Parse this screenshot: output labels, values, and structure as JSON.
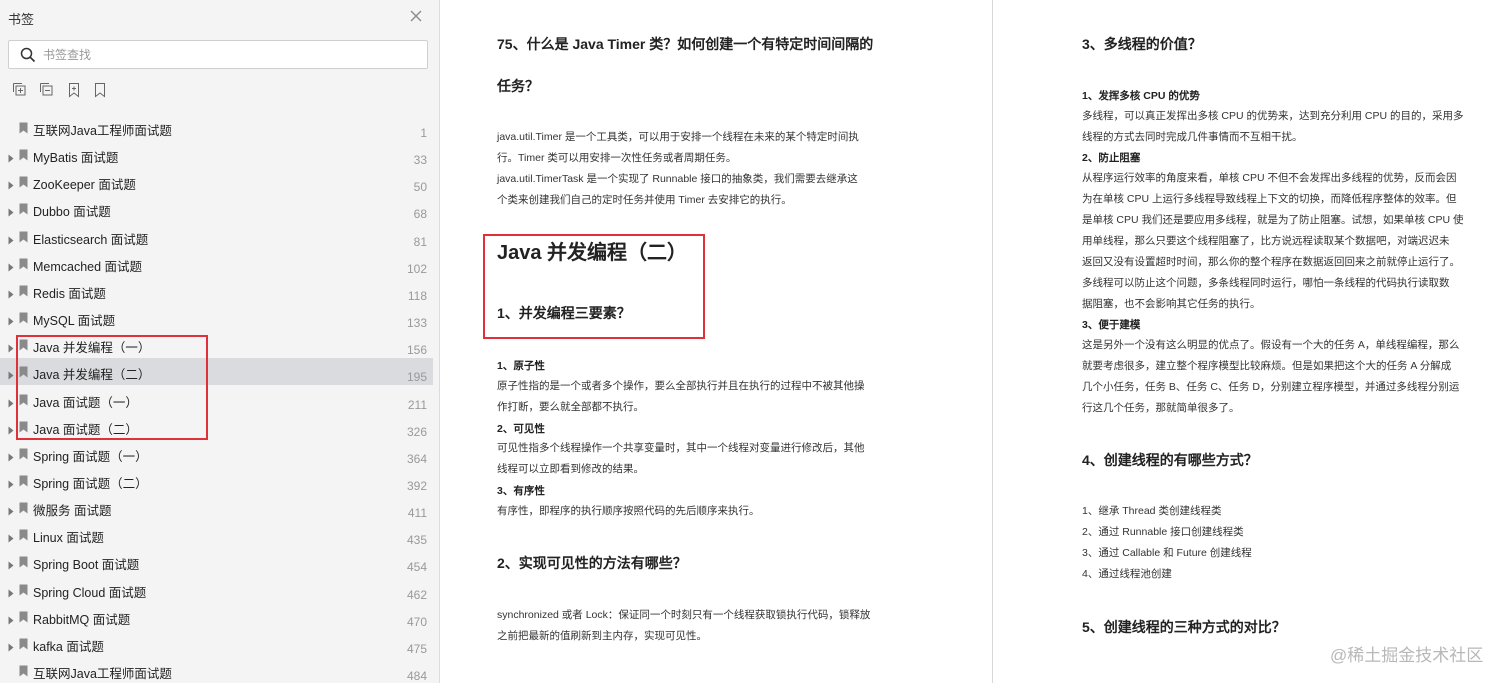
{
  "sidebar": {
    "title": "书签",
    "search_placeholder": "书签查找",
    "items": [
      {
        "label": "互联网Java工程师面试题",
        "page": "1",
        "expandable": false
      },
      {
        "label": "MyBatis 面试题",
        "page": "33",
        "expandable": true
      },
      {
        "label": "ZooKeeper 面试题",
        "page": "50",
        "expandable": true
      },
      {
        "label": "Dubbo 面试题",
        "page": "68",
        "expandable": true
      },
      {
        "label": "Elasticsearch 面试题",
        "page": "81",
        "expandable": true
      },
      {
        "label": "Memcached 面试题",
        "page": "102",
        "expandable": true
      },
      {
        "label": "Redis 面试题",
        "page": "118",
        "expandable": true
      },
      {
        "label": "MySQL 面试题",
        "page": "133",
        "expandable": true
      },
      {
        "label": "Java 并发编程（一）",
        "page": "156",
        "expandable": true
      },
      {
        "label": "Java 并发编程（二）",
        "page": "195",
        "expandable": true,
        "selected": true
      },
      {
        "label": "Java 面试题（一）",
        "page": "211",
        "expandable": true
      },
      {
        "label": "Java 面试题（二）",
        "page": "326",
        "expandable": true
      },
      {
        "label": "Spring 面试题（一）",
        "page": "364",
        "expandable": true
      },
      {
        "label": "Spring 面试题（二）",
        "page": "392",
        "expandable": true
      },
      {
        "label": "微服务 面试题",
        "page": "411",
        "expandable": true
      },
      {
        "label": "Linux 面试题",
        "page": "435",
        "expandable": true
      },
      {
        "label": "Spring Boot 面试题",
        "page": "454",
        "expandable": true
      },
      {
        "label": "Spring Cloud 面试题",
        "page": "462",
        "expandable": true
      },
      {
        "label": "RabbitMQ 面试题",
        "page": "470",
        "expandable": true
      },
      {
        "label": "kafka 面试题",
        "page": "475",
        "expandable": true
      },
      {
        "label": "互联网Java工程师面试题",
        "page": "484",
        "expandable": false
      }
    ]
  },
  "left_page": {
    "q75_title_line1": "75、什么是 Java Timer 类？如何创建一个有特定时间间隔的",
    "q75_title_line2": "任务？",
    "q75_p1": "java.util.Timer 是一个工具类，可以用于安排一个线程在未来的某个特定时间执",
    "q75_p2": "行。Timer 类可以用安排一次性任务或者周期任务。",
    "q75_p3": "java.util.TimerTask 是一个实现了 Runnable 接口的抽象类，我们需要去继承这",
    "q75_p4": "个类来创建我们自己的定时任务并使用 Timer 去安排它的执行。",
    "chapter_title": "Java  并发编程（二）",
    "q1_title": "1、并发编程三要素？",
    "s1_head": "1、原子性",
    "s1_p1": "原子性指的是一个或者多个操作，要么全部执行并且在执行的过程中不被其他操",
    "s1_p2": "作打断，要么就全部都不执行。",
    "s2_head": "2、可见性",
    "s2_p1": "可见性指多个线程操作一个共享变量时，其中一个线程对变量进行修改后，其他",
    "s2_p2": "线程可以立即看到修改的结果。",
    "s3_head": "3、有序性",
    "s3_p1": "有序性，即程序的执行顺序按照代码的先后顺序来执行。",
    "q2_title": "2、实现可见性的方法有哪些？",
    "q2_p1": "synchronized 或者 Lock：保证同一个时刻只有一个线程获取锁执行代码，锁释放",
    "q2_p2": "之前把最新的值刷新到主内存，实现可见性。"
  },
  "right_page": {
    "q3_title": "3、多线程的价值？",
    "a1_head": "1、发挥多核 CPU 的优势",
    "a1_p1": "多线程，可以真正发挥出多核 CPU 的优势来，达到充分利用 CPU 的目的，采用多",
    "a1_p2": "线程的方式去同时完成几件事情而不互相干扰。",
    "a2_head": "2、防止阻塞",
    "a2_p1": "从程序运行效率的角度来看，单核 CPU 不但不会发挥出多线程的优势，反而会因",
    "a2_p2": "为在单核 CPU 上运行多线程导致线程上下文的切换，而降低程序整体的效率。但",
    "a2_p3": "是单核 CPU 我们还是要应用多线程，就是为了防止阻塞。试想，如果单核 CPU 使",
    "a2_p4": "用单线程，那么只要这个线程阻塞了，比方说远程读取某个数据吧，对端迟迟未",
    "a2_p5": "返回又没有设置超时时间，那么你的整个程序在数据返回回来之前就停止运行了。",
    "a2_p6": "多线程可以防止这个问题，多条线程同时运行，哪怕一条线程的代码执行读取数",
    "a2_p7": "据阻塞，也不会影响其它任务的执行。",
    "a3_head": "3、便于建模",
    "a3_p1": "这是另外一个没有这么明显的优点了。假设有一个大的任务 A，单线程编程，那么",
    "a3_p2": "就要考虑很多，建立整个程序模型比较麻烦。但是如果把这个大的任务 A 分解成",
    "a3_p3": "几个小任务，任务 B、任务 C、任务 D，分别建立程序模型，并通过多线程分别运",
    "a3_p4": "行这几个任务，那就简单很多了。",
    "q4_title": "4、创建线程的有哪些方式？",
    "q4_items": [
      "1、继承 Thread 类创建线程类",
      "2、通过 Runnable 接口创建线程类",
      "3、通过 Callable 和 Future 创建线程",
      "4、通过线程池创建"
    ],
    "q5_title": "5、创建线程的三种方式的对比？"
  },
  "watermark": "@稀土掘金技术社区",
  "colors": {
    "highlight_box": "#e0313a",
    "sidebar_bg": "#f4f4f5",
    "selected_row": "#dadbde"
  }
}
